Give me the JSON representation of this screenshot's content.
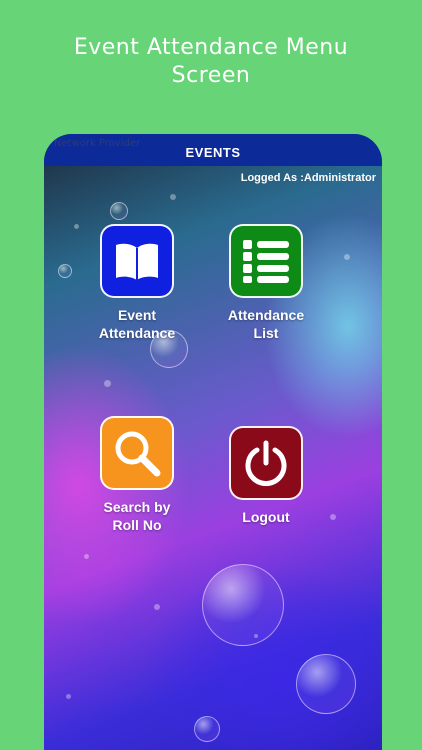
{
  "promo": {
    "title": "Event Attendance Menu Screen"
  },
  "status_bar": {
    "carrier": "Network Provider"
  },
  "app_bar": {
    "title": "EVENTS"
  },
  "session": {
    "logged_as": "Logged As :Administrator"
  },
  "menu": [
    {
      "label_line1": "Event",
      "label_line2": "Attendance",
      "icon": "book-icon",
      "color": "#1020e0"
    },
    {
      "label_line1": "Attendance",
      "label_line2": "List",
      "icon": "list-icon",
      "color": "#0e8a16"
    },
    {
      "label_line1": "Search by",
      "label_line2": "Roll No",
      "icon": "search-icon",
      "color": "#f7941d"
    },
    {
      "label_line1": "Logout",
      "label_line2": "",
      "icon": "power-icon",
      "color": "#8b0a1a"
    }
  ],
  "colors": {
    "background": "#66d477",
    "app_bar": "#0d2a99"
  }
}
